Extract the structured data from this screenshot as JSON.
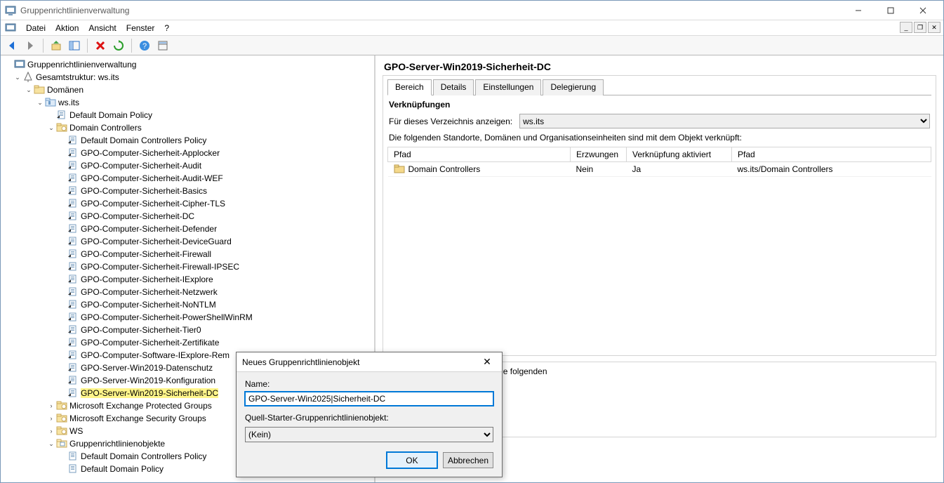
{
  "window": {
    "title": "Gruppenrichtlinienverwaltung"
  },
  "menu": {
    "file": "Datei",
    "action": "Aktion",
    "view": "Ansicht",
    "window": "Fenster",
    "help": "?"
  },
  "tree": {
    "root": "Gruppenrichtlinienverwaltung",
    "forest": "Gesamtstruktur: ws.its",
    "domains": "Domänen",
    "domain": "ws.its",
    "ddp": "Default Domain Policy",
    "dc_ou": "Domain Controllers",
    "dc_items": [
      "Default Domain Controllers Policy",
      "GPO-Computer-Sicherheit-Applocker",
      "GPO-Computer-Sicherheit-Audit",
      "GPO-Computer-Sicherheit-Audit-WEF",
      "GPO-Computer-Sicherheit-Basics",
      "GPO-Computer-Sicherheit-Cipher-TLS",
      "GPO-Computer-Sicherheit-DC",
      "GPO-Computer-Sicherheit-Defender",
      "GPO-Computer-Sicherheit-DeviceGuard",
      "GPO-Computer-Sicherheit-Firewall",
      "GPO-Computer-Sicherheit-Firewall-IPSEC",
      "GPO-Computer-Sicherheit-IExplore",
      "GPO-Computer-Sicherheit-Netzwerk",
      "GPO-Computer-Sicherheit-NoNTLM",
      "GPO-Computer-Sicherheit-PowerShellWinRM",
      "GPO-Computer-Sicherheit-Tier0",
      "GPO-Computer-Sicherheit-Zertifikate",
      "GPO-Computer-Software-IExplore-Rem",
      "GPO-Server-Win2019-Datenschutz",
      "GPO-Server-Win2019-Konfiguration",
      "GPO-Server-Win2019-Sicherheit-DC"
    ],
    "ous": [
      "Microsoft Exchange Protected Groups",
      "Microsoft Exchange Security Groups",
      "WS"
    ],
    "gpo_container": "Gruppenrichtlinienobjekte",
    "gpo_children": [
      "Default Domain Controllers Policy",
      "Default Domain Policy"
    ]
  },
  "detail": {
    "title": "GPO-Server-Win2019-Sicherheit-DC",
    "tabs": {
      "scope": "Bereich",
      "details": "Details",
      "settings": "Einstellungen",
      "delegation": "Delegierung"
    },
    "links_head": "Verknüpfungen",
    "display_label": "Für dieses Verzeichnis anzeigen:",
    "display_value": "ws.its",
    "links_note": "Die folgenden Standorte, Domänen und Organisationseinheiten sind mit dem Objekt verknüpft:",
    "cols": {
      "path1": "Pfad",
      "enforced": "Erzwungen",
      "enabled": "Verknüpfung aktiviert",
      "path2": "Pfad"
    },
    "row": {
      "location": "Domain Controllers",
      "enforced": "Nein",
      "enabled": "Ja",
      "path": "ws.its/Domain Controllers"
    },
    "filter_note": "htlinienobjekts gelten nur für die folgenden"
  },
  "dialog": {
    "title": "Neues Gruppenrichtlinienobjekt",
    "name_label": "Name:",
    "name_value": "GPO-Server-Win2025|Sicherheit-DC",
    "starter_label": "Quell-Starter-Gruppenrichtlinienobjekt:",
    "starter_value": "(Kein)",
    "ok": "OK",
    "cancel": "Abbrechen"
  }
}
